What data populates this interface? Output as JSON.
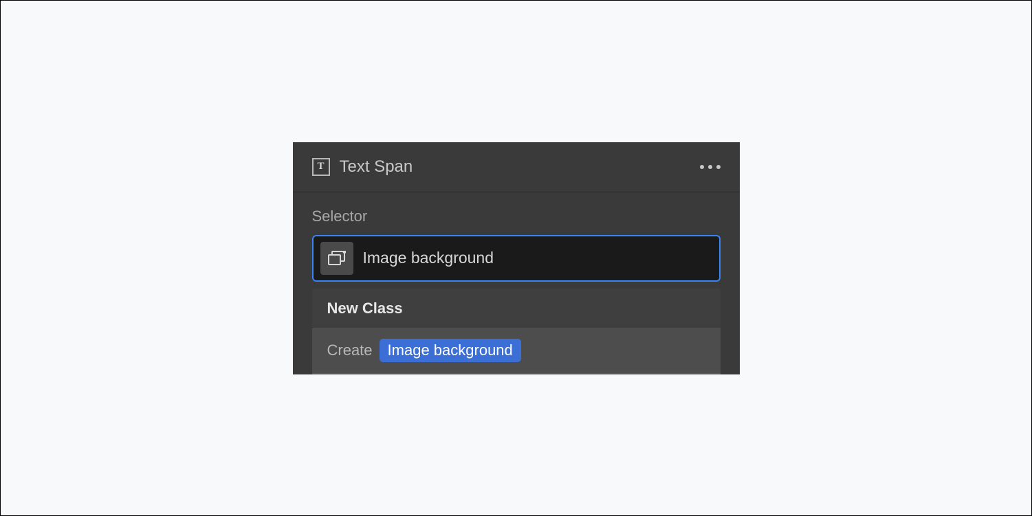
{
  "header": {
    "element_type": "Text Span"
  },
  "selector": {
    "label": "Selector",
    "input_value": "Image background"
  },
  "dropdown": {
    "heading": "New Class",
    "create_prefix": "Create",
    "create_class_name": "Image background"
  }
}
